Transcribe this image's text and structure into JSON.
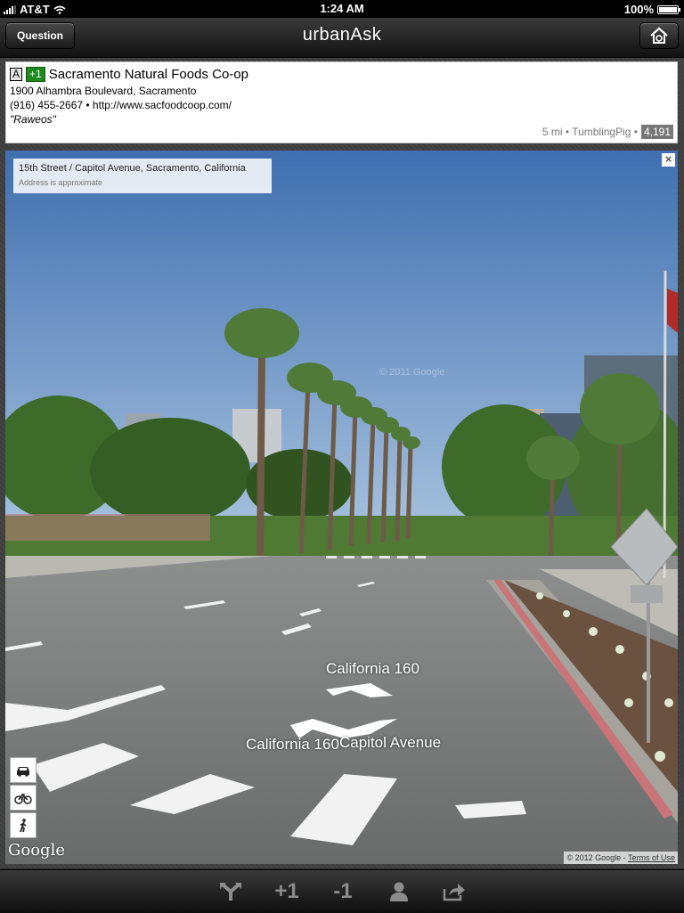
{
  "status": {
    "carrier": "AT&T",
    "time": "1:24 AM",
    "battery": "100%"
  },
  "nav": {
    "back_label": "Question",
    "title": "urbanAsk"
  },
  "place": {
    "badge_letter": "A",
    "badge_plus": "+1",
    "name": "Sacramento Natural Foods Co-op",
    "address": "1900 Alhambra Boulevard, Sacramento",
    "contact": "(916) 455-2667 • http://www.sacfoodcoop.com/",
    "quote": "\"Raweos\"",
    "meta": "5 mi • TumblingPig •",
    "score": "4,191"
  },
  "streetview": {
    "address": "15th Street / Capitol Avenue, Sacramento, California",
    "note": "Address is approximate",
    "close": "×",
    "label_1": "California 160",
    "label_2": "California 160",
    "label_3": "Capitol Avenue",
    "google_logo": "Google",
    "copyright": "© 2012 Google -",
    "terms": "Terms of Use",
    "watermark": "© 2011 Google",
    "modes": [
      "car-icon",
      "bicycle-icon",
      "walking-icon"
    ]
  },
  "toolbar": {
    "items": [
      {
        "icon": "directions-fork-icon"
      },
      {
        "label": "+1"
      },
      {
        "label": "-1"
      },
      {
        "icon": "person-icon"
      },
      {
        "icon": "share-icon"
      }
    ]
  }
}
